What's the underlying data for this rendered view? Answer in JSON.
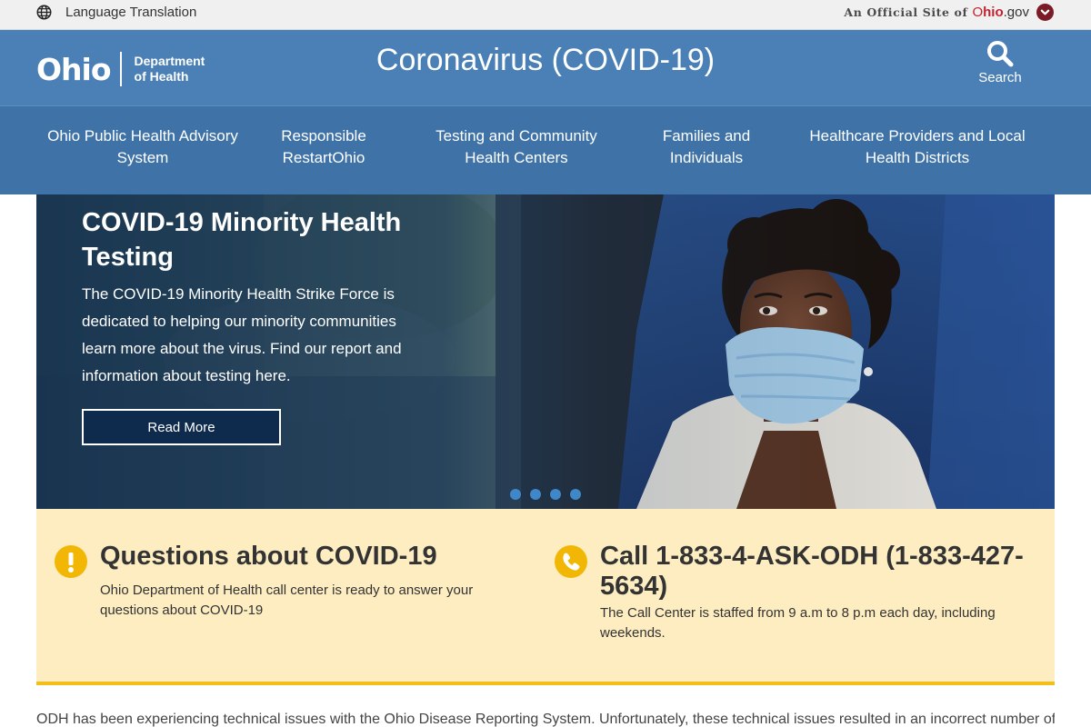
{
  "topbar": {
    "language_label": "Language Translation",
    "official_text": "An Official Site of",
    "ohio_gov_o": "O",
    "ohio_gov_hio": "hio",
    "ohio_gov_suffix": ".gov"
  },
  "header": {
    "logo_word": "Ohio",
    "dept_line1": "Department",
    "dept_line2": "of Health",
    "site_title": "Coronavirus (COVID-19)",
    "search_label": "Search"
  },
  "nav": {
    "items": [
      {
        "label_line1": "Ohio Public Health Advisory",
        "label_line2": "System"
      },
      {
        "label_line1": "Responsible",
        "label_line2": "RestartOhio"
      },
      {
        "label_line1": "Testing and Community",
        "label_line2": "Health Centers"
      },
      {
        "label_line1": "Families and",
        "label_line2": "Individuals"
      },
      {
        "label_line1": "Healthcare Providers and Local",
        "label_line2": "Health Districts"
      }
    ]
  },
  "hero": {
    "title_line1": "COVID-19 Minority Health",
    "title_line2": "Testing",
    "text": "The COVID-19 Minority Health Strike Force is dedicated to helping our minority communities learn more about the virus. Find our report and information about testing here.",
    "button_label": "Read More",
    "slide_count": 4
  },
  "info": {
    "questions_title": "Questions about COVID-19",
    "questions_text": "Ohio Department of Health call center is ready to answer your questions about COVID-19",
    "call_title": "Call 1-833-4-ASK-ODH (1-833-427-5634)",
    "call_text": "The Call Center is staffed from 9 a.m to 8 p.m each day, including weekends."
  },
  "notice": "ODH has been experiencing technical issues with the Ohio Disease Reporting System. Unfortunately, these technical issues resulted in an incorrect number of deaths",
  "colors": {
    "header_blue": "#4a80b5",
    "nav_blue": "#3f73a8",
    "info_bg": "#fdedc1",
    "info_accent": "#f2b705",
    "ohio_red": "#c2222f"
  },
  "icons": [
    "globe-icon",
    "chevron-down-icon",
    "search-icon",
    "exclamation-icon",
    "phone-icon"
  ]
}
